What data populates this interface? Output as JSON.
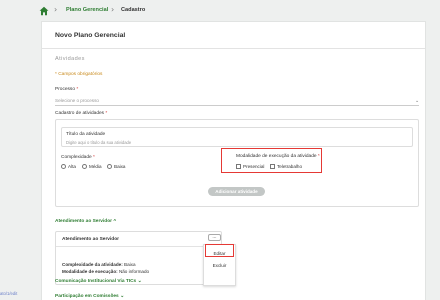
{
  "breadcrumb": {
    "item1": "Plano Gerencial",
    "item2": "Cadastro"
  },
  "panel": {
    "title": "Novo Plano Gerencial",
    "section": "Atividades",
    "required_note": "* Campos obrigatórios"
  },
  "processo": {
    "label": "Processo",
    "placeholder": "Selecione o processo"
  },
  "cadastro": {
    "label": "Cadastro de atividades",
    "titulo_label": "Título da atividade",
    "titulo_placeholder": "Digite aqui o título da sua atividade",
    "complexidade_label": "Complexidade",
    "complexidade_options": [
      "Alta",
      "Média",
      "Baixa"
    ],
    "modalidade_label": "Modalidade de execução da atividade",
    "modalidade_options": [
      "Presencial",
      "Teletrabalho"
    ],
    "add_button": "Adicionar atividade"
  },
  "accordion": {
    "title": "Atendimento ao Servidor",
    "item_title": "Atendimento ao Servidor",
    "complexidade_label": "Complexidade da atividade:",
    "complexidade_value": "Baixa",
    "modalidade_label": "Modalidade de execução:",
    "modalidade_value": "Não informado",
    "menu": {
      "edit": "Editar",
      "delete": "Excluir"
    }
  },
  "other_sections": [
    "Comunicação Institucional Via TICs",
    "Participação em Comissões"
  ],
  "side_tag": "ato/1/edit"
}
